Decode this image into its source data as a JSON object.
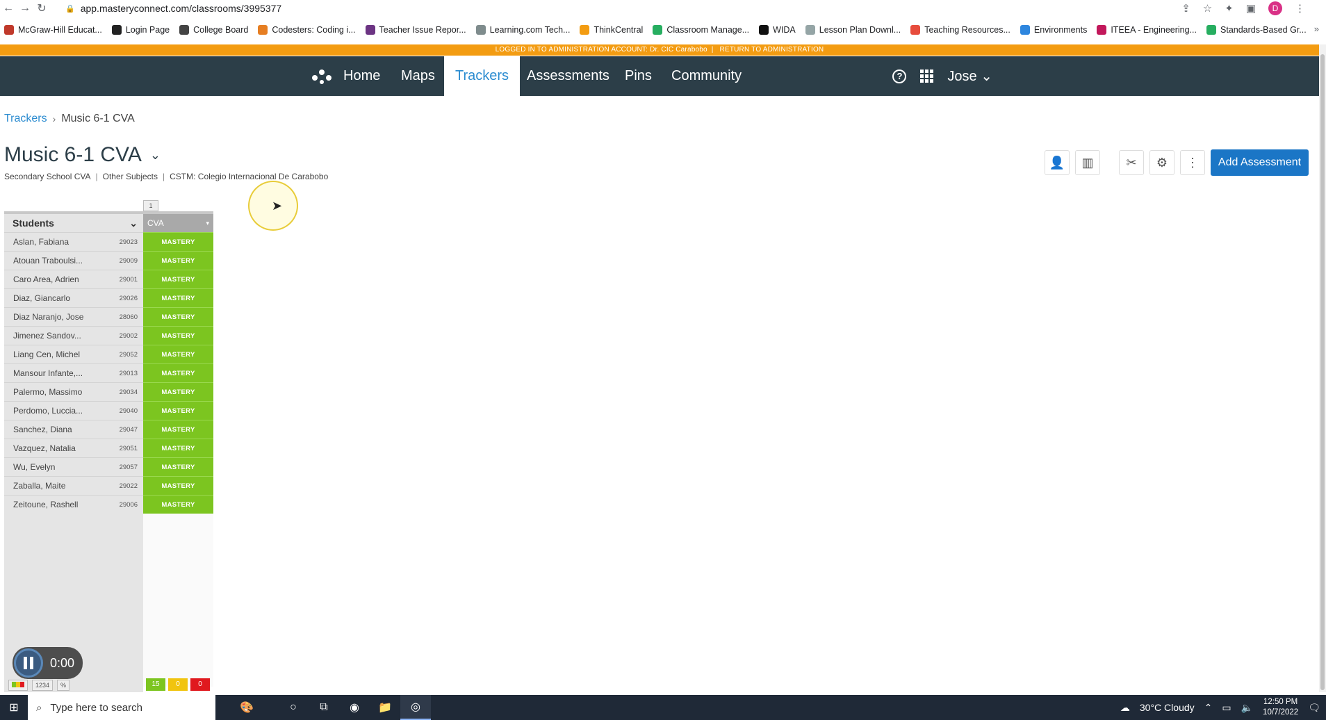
{
  "browser": {
    "url": "app.masteryconnect.com/classrooms/3995377",
    "profile_initial": "D",
    "bookmarks": [
      {
        "label": "McGraw-Hill Educat...",
        "color": "#c0392b"
      },
      {
        "label": "Login Page",
        "color": "#222222"
      },
      {
        "label": "College Board",
        "color": "#444444"
      },
      {
        "label": "Codesters: Coding i...",
        "color": "#e67e22"
      },
      {
        "label": "Teacher Issue Repor...",
        "color": "#6c3483"
      },
      {
        "label": "Learning.com Tech...",
        "color": "#7f8c8d"
      },
      {
        "label": "ThinkCentral",
        "color": "#f39c12"
      },
      {
        "label": "Classroom Manage...",
        "color": "#27ae60"
      },
      {
        "label": "WIDA",
        "color": "#111111"
      },
      {
        "label": "Lesson Plan Downl...",
        "color": "#95a5a6"
      },
      {
        "label": "Teaching Resources...",
        "color": "#e74c3c"
      },
      {
        "label": "Environments",
        "color": "#2e86de"
      },
      {
        "label": "ITEEA - Engineering...",
        "color": "#c2185b"
      },
      {
        "label": "Standards-Based Gr...",
        "color": "#27ae60"
      }
    ]
  },
  "admin_banner": {
    "logged_in": "LOGGED IN TO ADMINISTRATION ACCOUNT: Dr. CIC Carabobo",
    "return": "RETURN TO ADMINISTRATION"
  },
  "nav": {
    "home": "Home",
    "maps": "Maps",
    "trackers": "Trackers",
    "assessments": "Assessments",
    "pins": "Pins",
    "community": "Community",
    "user": "Jose"
  },
  "breadcrumb": {
    "root": "Trackers",
    "current": "Music 6-1 CVA"
  },
  "page": {
    "title": "Music 6-1 CVA",
    "school": "Secondary School CVA",
    "subject": "Other Subjects",
    "cstm": "CSTM: Colegio Internacional De Carabobo",
    "add_assessment": "Add Assessment"
  },
  "tracker": {
    "column_toggle": "1",
    "students_header": "Students",
    "assessment_header": "CVA",
    "status_label": "MASTERY",
    "students": [
      {
        "name": "Aslan, Fabiana",
        "id": "29023"
      },
      {
        "name": "Atouan Traboulsi...",
        "id": "29009"
      },
      {
        "name": "Caro Area, Adrien",
        "id": "29001"
      },
      {
        "name": "Diaz, Giancarlo",
        "id": "29026"
      },
      {
        "name": "Diaz Naranjo, Jose",
        "id": "28060"
      },
      {
        "name": "Jimenez Sandov...",
        "id": "29002"
      },
      {
        "name": "Liang Cen, Michel",
        "id": "29052"
      },
      {
        "name": "Mansour Infante,...",
        "id": "29013"
      },
      {
        "name": "Palermo, Massimo",
        "id": "29034"
      },
      {
        "name": "Perdomo, Luccia...",
        "id": "29040"
      },
      {
        "name": "Sanchez, Diana",
        "id": "29047"
      },
      {
        "name": "Vazquez, Natalia",
        "id": "29051"
      },
      {
        "name": "Wu, Evelyn",
        "id": "29057"
      },
      {
        "name": "Zaballa, Maite",
        "id": "29022"
      },
      {
        "name": "Zeitoune, Rashell",
        "id": "29006"
      }
    ],
    "footer": {
      "num_label": "1234",
      "pct_label": "%",
      "mastery_count": "15",
      "near_count": "0",
      "remediation_count": "0"
    }
  },
  "recorder": {
    "time": "0:00"
  },
  "taskbar": {
    "search_placeholder": "Type here to search",
    "weather": "30°C  Cloudy",
    "time": "12:50 PM",
    "date": "10/7/2022"
  },
  "colors": {
    "nav_bg": "#2c3e48",
    "accent": "#2a8bd0",
    "mastery": "#7cc520",
    "near": "#f1c40f",
    "remediation": "#e0191e",
    "admin_banner": "#f39c12"
  }
}
